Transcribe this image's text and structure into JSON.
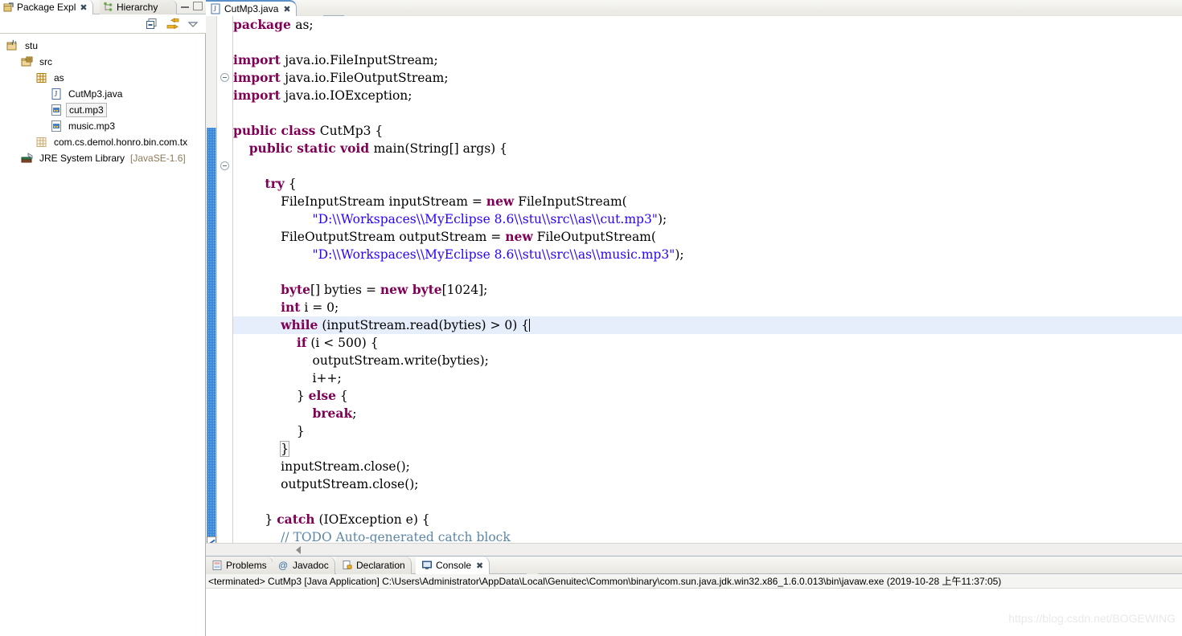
{
  "left_panel": {
    "tabs": [
      {
        "label": "Package Expl",
        "icon": "package-explorer-icon",
        "active": true,
        "closable": true
      },
      {
        "label": "Hierarchy",
        "icon": "hierarchy-icon",
        "active": false,
        "closable": false
      }
    ],
    "toolbar": [
      {
        "name": "collapse-all-icon",
        "label": "Collapse All"
      },
      {
        "name": "link-with-editor-icon",
        "label": "Link with Editor"
      },
      {
        "name": "view-menu-icon",
        "label": "View Menu"
      }
    ],
    "window_buttons": [
      {
        "name": "minimize-button",
        "label": "Minimize"
      },
      {
        "name": "maximize-button",
        "label": "Maximize"
      }
    ],
    "tree": [
      {
        "label": "stu",
        "icon": "java-project-icon",
        "depth": 0,
        "selected": false
      },
      {
        "label": "src",
        "icon": "source-folder-icon",
        "depth": 1,
        "selected": false
      },
      {
        "label": "as",
        "icon": "package-icon",
        "depth": 2,
        "selected": false
      },
      {
        "label": "CutMp3.java",
        "icon": "java-file-icon",
        "depth": 3,
        "selected": false
      },
      {
        "label": "cut.mp3",
        "icon": "file-icon",
        "depth": 3,
        "selected": true
      },
      {
        "label": "music.mp3",
        "icon": "file-icon",
        "depth": 3,
        "selected": false
      },
      {
        "label": "com.cs.demol.honro.bin.com.tx",
        "icon": "package-empty-icon",
        "depth": 2,
        "selected": false
      },
      {
        "label": "JRE System Library",
        "suffix": "[JavaSE-1.6]",
        "icon": "library-icon",
        "depth": 1,
        "selected": false
      }
    ]
  },
  "editor": {
    "tab": {
      "label": "CutMp3.java",
      "icon": "java-file-icon",
      "active": true,
      "closable": true
    },
    "lines": [
      {
        "n": 1,
        "fold": false,
        "current": false,
        "tokens": [
          {
            "t": "package ",
            "c": "kw"
          },
          {
            "t": "as;",
            "c": ""
          }
        ]
      },
      {
        "n": 2,
        "fold": false,
        "current": false,
        "tokens": []
      },
      {
        "n": 3,
        "fold": true,
        "current": false,
        "tokens": [
          {
            "t": "import ",
            "c": "kw"
          },
          {
            "t": "java.io.FileInputStream;",
            "c": ""
          }
        ]
      },
      {
        "n": 4,
        "fold": false,
        "current": false,
        "tokens": [
          {
            "t": "import ",
            "c": "kw"
          },
          {
            "t": "java.io.FileOutputStream;",
            "c": ""
          }
        ]
      },
      {
        "n": 5,
        "fold": false,
        "current": false,
        "tokens": [
          {
            "t": "import ",
            "c": "kw"
          },
          {
            "t": "java.io.IOException;",
            "c": ""
          }
        ]
      },
      {
        "n": 6,
        "fold": false,
        "current": false,
        "tokens": []
      },
      {
        "n": 7,
        "fold": false,
        "current": false,
        "tokens": [
          {
            "t": "public class ",
            "c": "kw"
          },
          {
            "t": "CutMp3 {",
            "c": ""
          }
        ]
      },
      {
        "n": 8,
        "fold": true,
        "current": false,
        "tokens": [
          {
            "t": "    ",
            "c": ""
          },
          {
            "t": "public static void ",
            "c": "kw"
          },
          {
            "t": "main(String[] args) {",
            "c": ""
          }
        ]
      },
      {
        "n": 9,
        "fold": false,
        "current": false,
        "tokens": []
      },
      {
        "n": 10,
        "fold": false,
        "current": false,
        "tokens": [
          {
            "t": "        ",
            "c": ""
          },
          {
            "t": "try",
            "c": "kw"
          },
          {
            "t": " {",
            "c": ""
          }
        ]
      },
      {
        "n": 11,
        "fold": false,
        "current": false,
        "tokens": [
          {
            "t": "            FileInputStream inputStream = ",
            "c": ""
          },
          {
            "t": "new",
            "c": "kw"
          },
          {
            "t": " FileInputStream(",
            "c": ""
          }
        ]
      },
      {
        "n": 12,
        "fold": false,
        "current": false,
        "tokens": [
          {
            "t": "                    ",
            "c": ""
          },
          {
            "t": "\"D:\\\\Workspaces\\\\MyEclipse 8.6\\\\stu\\\\src\\\\as\\\\cut.mp3\"",
            "c": "str"
          },
          {
            "t": ");",
            "c": ""
          }
        ]
      },
      {
        "n": 13,
        "fold": false,
        "current": false,
        "tokens": [
          {
            "t": "            FileOutputStream outputStream = ",
            "c": ""
          },
          {
            "t": "new",
            "c": "kw"
          },
          {
            "t": " FileOutputStream(",
            "c": ""
          }
        ]
      },
      {
        "n": 14,
        "fold": false,
        "current": false,
        "tokens": [
          {
            "t": "                    ",
            "c": ""
          },
          {
            "t": "\"D:\\\\Workspaces\\\\MyEclipse 8.6\\\\stu\\\\src\\\\as\\\\music.mp3\"",
            "c": "str"
          },
          {
            "t": ");",
            "c": ""
          }
        ]
      },
      {
        "n": 15,
        "fold": false,
        "current": false,
        "tokens": []
      },
      {
        "n": 16,
        "fold": false,
        "current": false,
        "tokens": [
          {
            "t": "            ",
            "c": ""
          },
          {
            "t": "byte",
            "c": "kw"
          },
          {
            "t": "[] byties = ",
            "c": ""
          },
          {
            "t": "new byte",
            "c": "kw"
          },
          {
            "t": "[1024];",
            "c": ""
          }
        ]
      },
      {
        "n": 17,
        "fold": false,
        "current": false,
        "tokens": [
          {
            "t": "            ",
            "c": ""
          },
          {
            "t": "int",
            "c": "kw"
          },
          {
            "t": " i = 0;",
            "c": ""
          }
        ]
      },
      {
        "n": 18,
        "fold": false,
        "current": true,
        "tokens": [
          {
            "t": "            ",
            "c": ""
          },
          {
            "t": "while",
            "c": "kw"
          },
          {
            "t": " (inputStream.read(byties) > 0) {",
            "c": ""
          }
        ],
        "caret": true
      },
      {
        "n": 19,
        "fold": false,
        "current": false,
        "tokens": [
          {
            "t": "                ",
            "c": ""
          },
          {
            "t": "if",
            "c": "kw"
          },
          {
            "t": " (i < 500) {",
            "c": ""
          }
        ]
      },
      {
        "n": 20,
        "fold": false,
        "current": false,
        "tokens": [
          {
            "t": "                    outputStream.write(byties);",
            "c": ""
          }
        ]
      },
      {
        "n": 21,
        "fold": false,
        "current": false,
        "tokens": [
          {
            "t": "                    i++;",
            "c": ""
          }
        ]
      },
      {
        "n": 22,
        "fold": false,
        "current": false,
        "tokens": [
          {
            "t": "                } ",
            "c": ""
          },
          {
            "t": "else",
            "c": "kw"
          },
          {
            "t": " {",
            "c": ""
          }
        ]
      },
      {
        "n": 23,
        "fold": false,
        "current": false,
        "tokens": [
          {
            "t": "                    ",
            "c": ""
          },
          {
            "t": "break",
            "c": "kw"
          },
          {
            "t": ";",
            "c": ""
          }
        ]
      },
      {
        "n": 24,
        "fold": false,
        "current": false,
        "tokens": [
          {
            "t": "                }",
            "c": ""
          }
        ]
      },
      {
        "n": 25,
        "fold": false,
        "current": false,
        "tokens": [
          {
            "t": "            ",
            "c": ""
          },
          {
            "t": "}",
            "c": "brace-box"
          }
        ]
      },
      {
        "n": 26,
        "fold": false,
        "current": false,
        "tokens": [
          {
            "t": "            inputStream.close();",
            "c": ""
          }
        ]
      },
      {
        "n": 27,
        "fold": false,
        "current": false,
        "tokens": [
          {
            "t": "            outputStream.close();",
            "c": ""
          }
        ]
      },
      {
        "n": 28,
        "fold": false,
        "current": false,
        "tokens": []
      },
      {
        "n": 29,
        "fold": false,
        "current": false,
        "tokens": [
          {
            "t": "        } ",
            "c": ""
          },
          {
            "t": "catch",
            "c": "kw"
          },
          {
            "t": " (IOException e) {",
            "c": ""
          }
        ]
      },
      {
        "n": 30,
        "fold": false,
        "current": false,
        "tokens": [
          {
            "t": "            // TODO Auto-generated catch block",
            "c": "cmt"
          }
        ]
      }
    ]
  },
  "bottom_panel": {
    "tabs": [
      {
        "label": "Problems",
        "icon": "problems-icon",
        "active": false,
        "closable": false
      },
      {
        "label": "Javadoc",
        "icon": "javadoc-icon",
        "active": false,
        "closable": false
      },
      {
        "label": "Declaration",
        "icon": "declaration-icon",
        "active": false,
        "closable": false
      },
      {
        "label": "Console",
        "icon": "console-icon",
        "active": true,
        "closable": true
      }
    ],
    "console_status": "<terminated> CutMp3 [Java Application] C:\\Users\\Administrator\\AppData\\Local\\Genuitec\\Common\\binary\\com.sun.java.jdk.win32.x86_1.6.0.013\\bin\\javaw.exe (2019-10-28 上午11:37:05)",
    "console_output": ""
  },
  "watermark": "https://blog.csdn.net/BOGEWING",
  "colors": {
    "keyword": "#7f0055",
    "string": "#2a00ff",
    "comment": "#5b86a8",
    "current_line": "#e6eefb",
    "tab_accent": "#5a8fc8",
    "ruler_range": "#2f7fd4"
  }
}
